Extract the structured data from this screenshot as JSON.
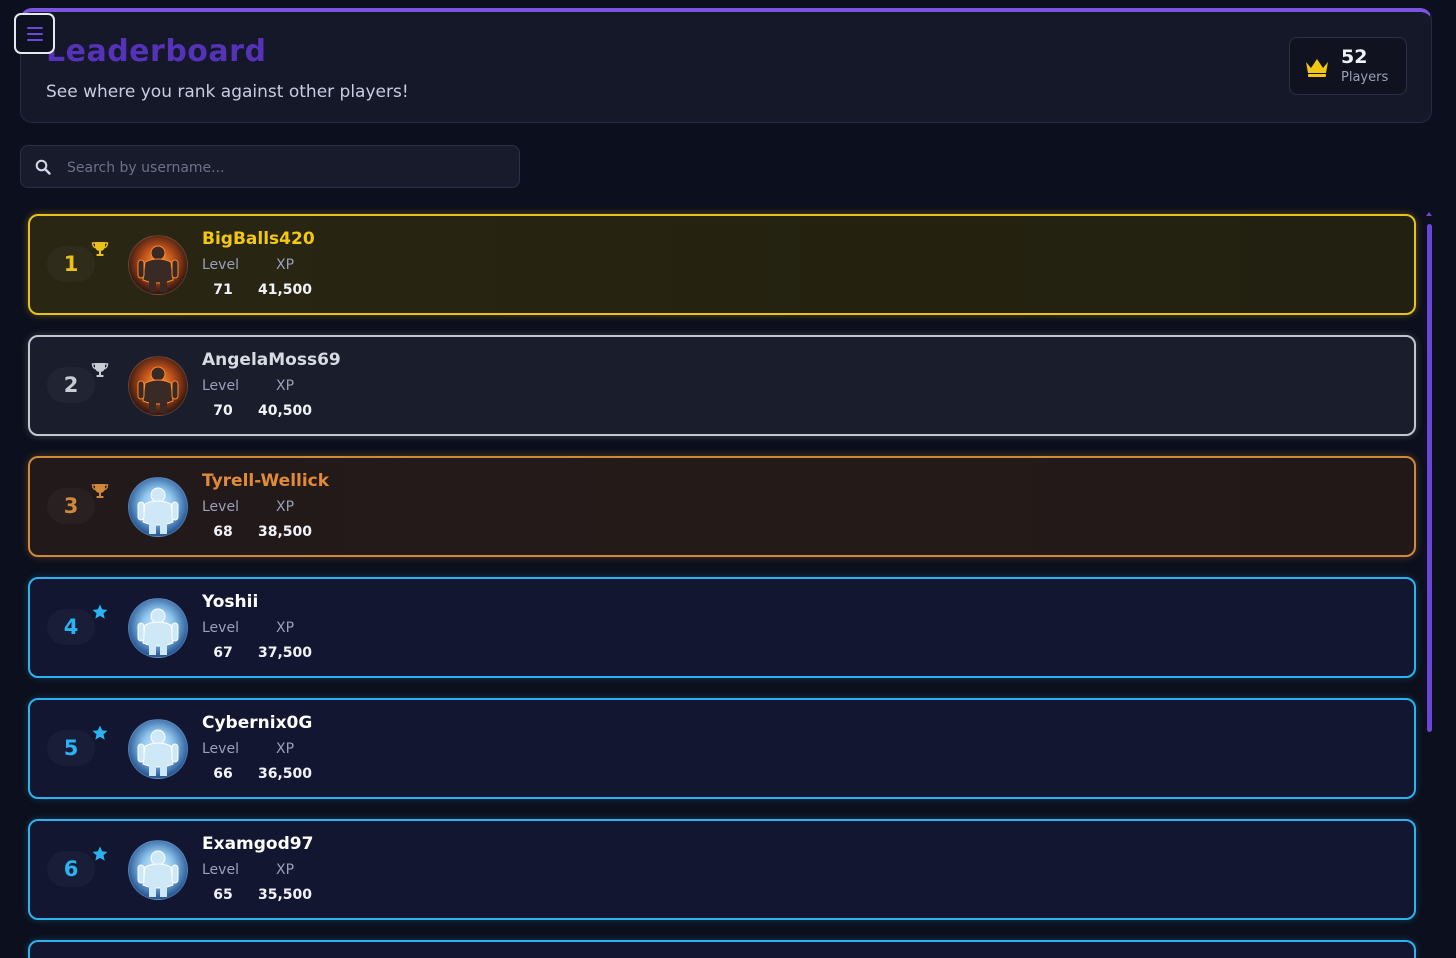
{
  "header": {
    "title": "Leaderboard",
    "subtitle": "See where you rank against other players!",
    "players_count": "52",
    "players_label": "Players"
  },
  "search": {
    "placeholder": "Search by username..."
  },
  "labels": {
    "level": "Level",
    "xp": "XP"
  },
  "colors": {
    "accent": "#6a46d4",
    "gold": "#e8c11a",
    "silver": "#c3c6cf",
    "bronze": "#d0883a",
    "blue": "#2ab3f0"
  },
  "players": [
    {
      "rank": "1",
      "username": "BigBalls420",
      "level": "71",
      "xp": "41,500",
      "tier": "gold",
      "badge_icon": "trophy-icon",
      "avatar": "fire-warrior-avatar"
    },
    {
      "rank": "2",
      "username": "AngelaMoss69",
      "level": "70",
      "xp": "40,500",
      "tier": "silver",
      "badge_icon": "trophy-icon",
      "avatar": "fire-warrior-avatar"
    },
    {
      "rank": "3",
      "username": "Tyrell-Wellick",
      "level": "68",
      "xp": "38,500",
      "tier": "bronze",
      "badge_icon": "trophy-icon",
      "avatar": "ice-warrior-avatar"
    },
    {
      "rank": "4",
      "username": "Yoshii",
      "level": "67",
      "xp": "37,500",
      "tier": "blue",
      "badge_icon": "star-icon",
      "avatar": "ice-warrior-avatar"
    },
    {
      "rank": "5",
      "username": "Cybernix0G",
      "level": "66",
      "xp": "36,500",
      "tier": "blue",
      "badge_icon": "star-icon",
      "avatar": "ice-warrior-avatar"
    },
    {
      "rank": "6",
      "username": "Examgod97",
      "level": "65",
      "xp": "35,500",
      "tier": "blue",
      "badge_icon": "star-icon",
      "avatar": "ice-warrior-avatar"
    }
  ]
}
